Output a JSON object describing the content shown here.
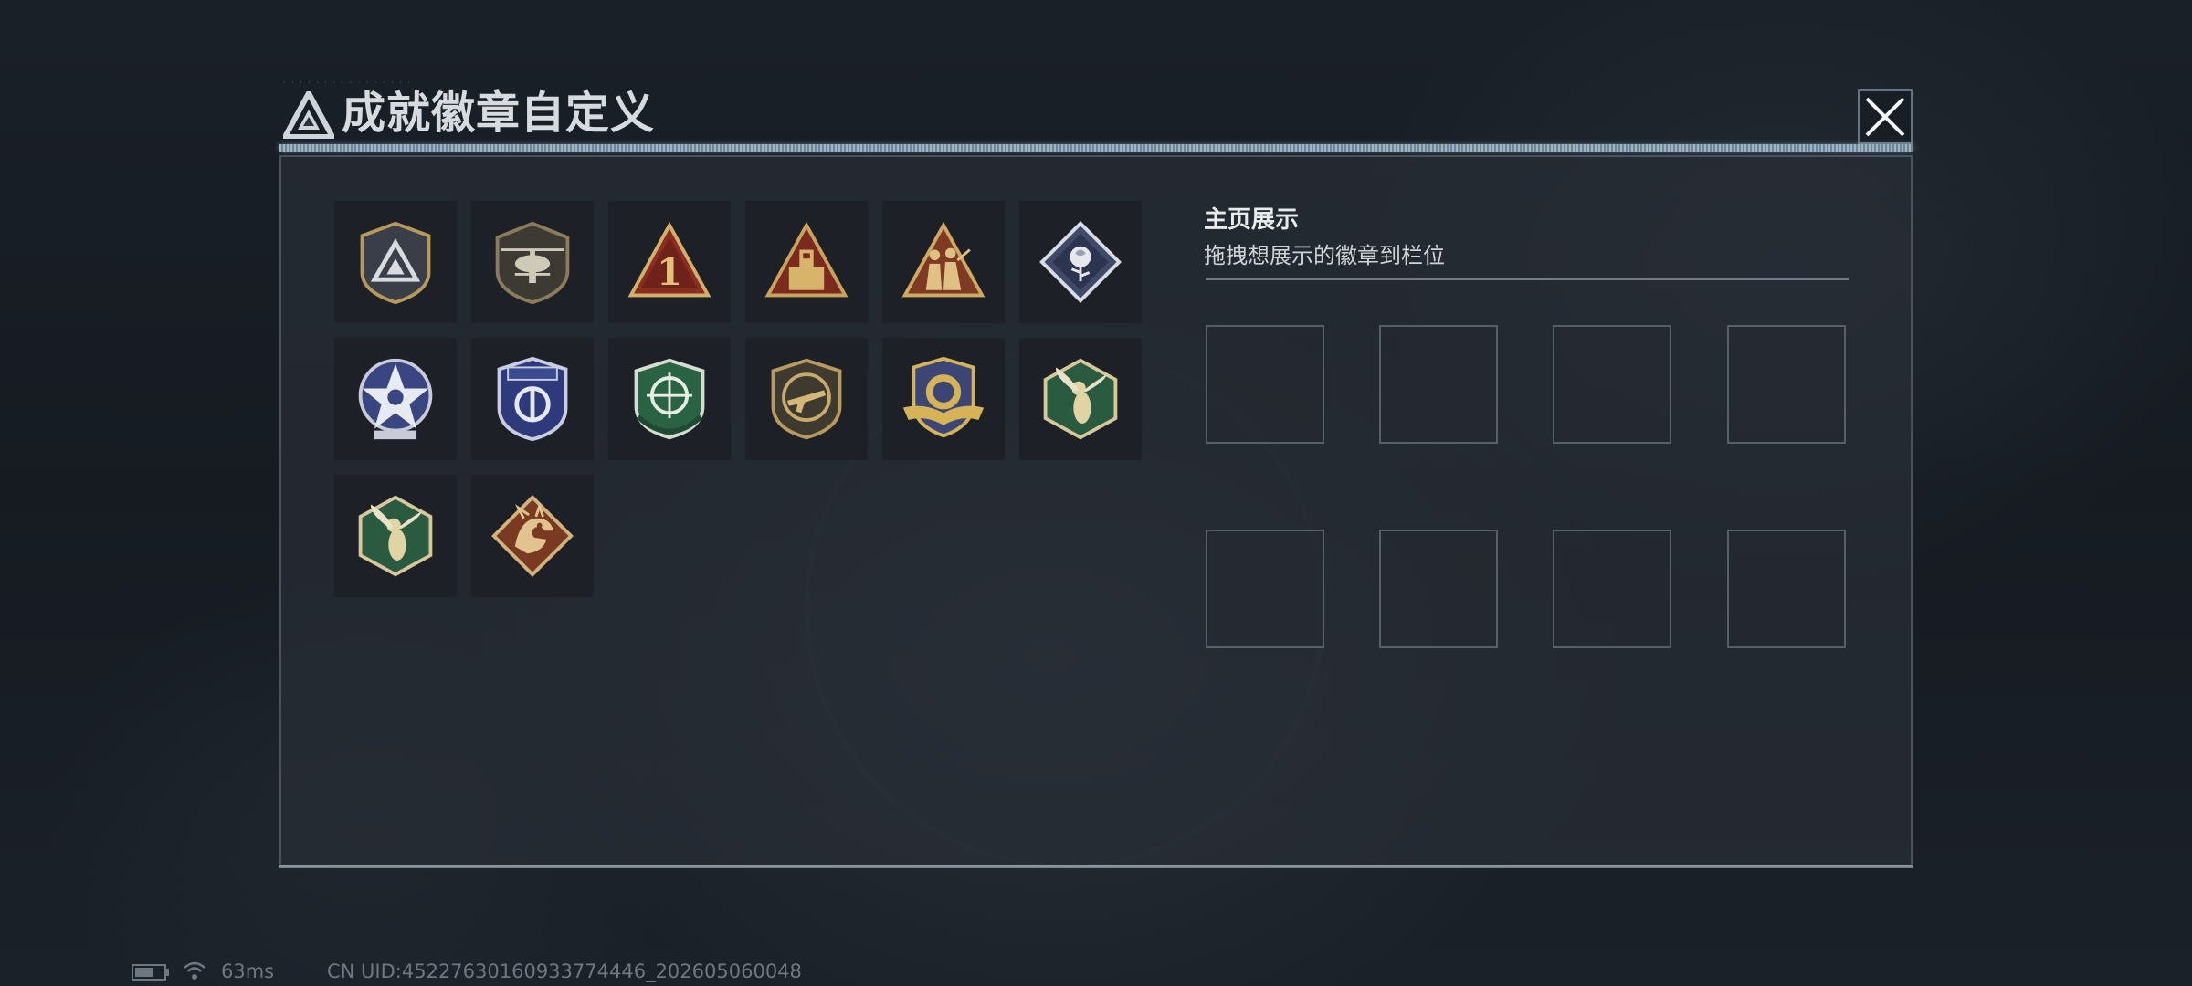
{
  "window": {
    "title": "成就徽章自定义",
    "header_tiny_text": "· · · · · · · · · · · · · · · ·"
  },
  "badges": [
    {
      "id": "badge-triangle-shield",
      "icon": "triangle-emblem-shield-icon"
    },
    {
      "id": "badge-helicopter",
      "icon": "helicopter-shield-icon"
    },
    {
      "id": "badge-number-one",
      "icon": "triangle-number-one-icon"
    },
    {
      "id": "badge-tower",
      "icon": "triangle-tower-icon"
    },
    {
      "id": "badge-soldiers",
      "icon": "triangle-soldiers-icon"
    },
    {
      "id": "badge-rose",
      "icon": "diamond-rose-icon"
    },
    {
      "id": "badge-star",
      "icon": "blue-star-medal-icon"
    },
    {
      "id": "badge-blue-shield",
      "icon": "blue-shield-crest-icon"
    },
    {
      "id": "badge-green-crosshair",
      "icon": "green-crosshair-rifle-icon"
    },
    {
      "id": "badge-bronze-rifle",
      "icon": "bronze-rifle-shield-icon"
    },
    {
      "id": "badge-gold-wings",
      "icon": "gold-winged-crest-icon"
    },
    {
      "id": "badge-hornet-1",
      "icon": "hexagon-hornet-icon"
    },
    {
      "id": "badge-hornet-2",
      "icon": "hexagon-hornet-icon"
    },
    {
      "id": "badge-dragon",
      "icon": "diamond-dragon-icon"
    }
  ],
  "showcase": {
    "title": "主页展示",
    "hint": "拖拽想展示的徽章到栏位",
    "slot_count": 8
  },
  "status_bar": {
    "ping": "63ms",
    "uid": "CN UID:4522763016093​3774446_202605060048"
  },
  "colors": {
    "panel_bg": "#2e343c",
    "title_text": "#d7dbe0",
    "accent_gold": "#c9a24a",
    "accent_green": "#2e6a4a",
    "accent_blue": "#3c4a8c",
    "accent_bronze": "#8a4a2a"
  }
}
